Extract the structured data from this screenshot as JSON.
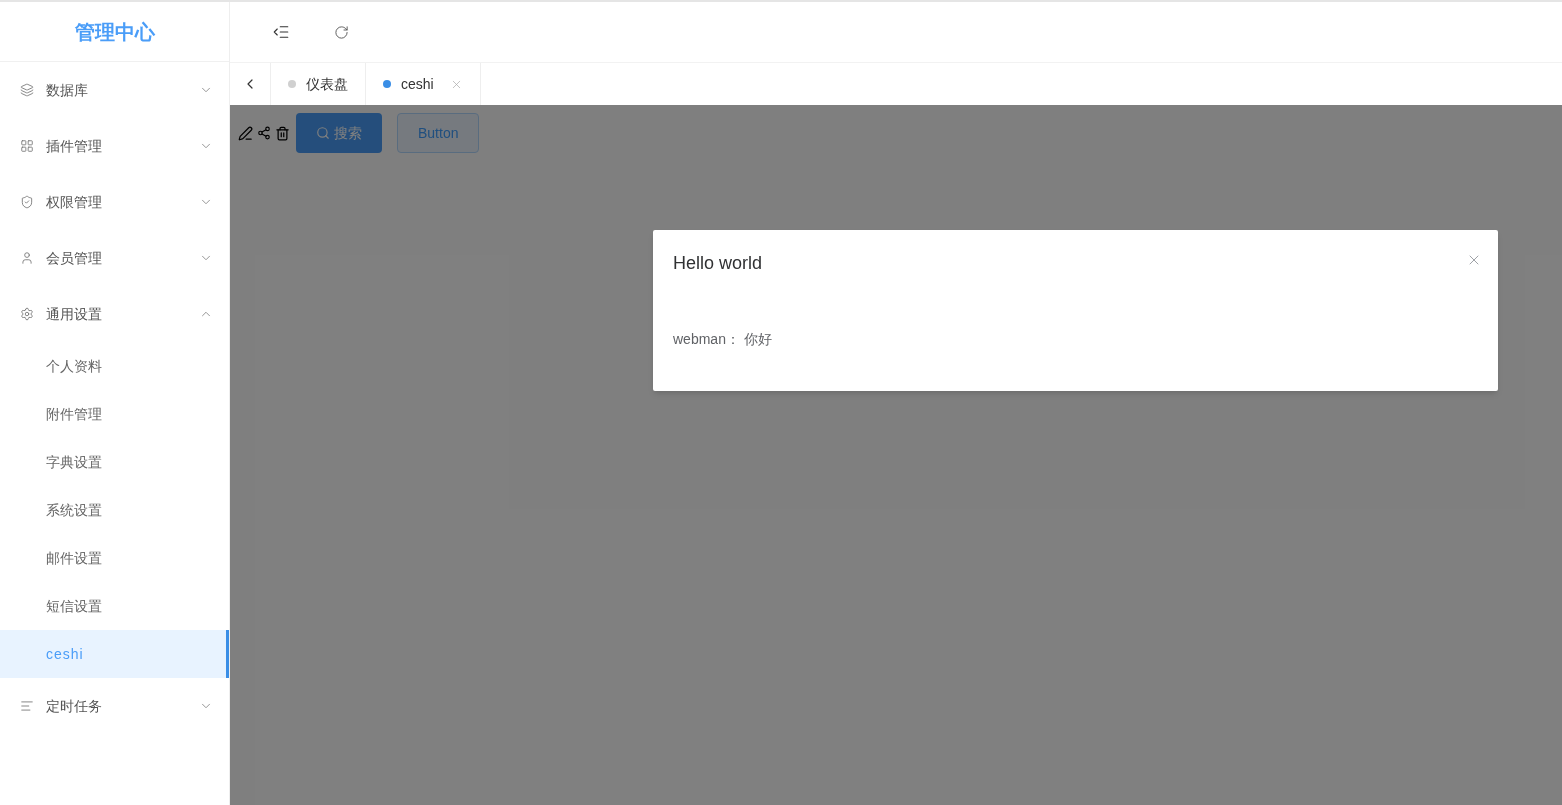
{
  "logo": "管理中心",
  "menu": [
    {
      "label": "数据库",
      "expanded": false
    },
    {
      "label": "插件管理",
      "expanded": false
    },
    {
      "label": "权限管理",
      "expanded": false
    },
    {
      "label": "会员管理",
      "expanded": false
    },
    {
      "label": "通用设置",
      "expanded": true,
      "children": [
        {
          "label": "个人资料",
          "selected": false
        },
        {
          "label": "附件管理",
          "selected": false
        },
        {
          "label": "字典设置",
          "selected": false
        },
        {
          "label": "系统设置",
          "selected": false
        },
        {
          "label": "邮件设置",
          "selected": false
        },
        {
          "label": "短信设置",
          "selected": false
        },
        {
          "label": "ceshi",
          "selected": true
        }
      ]
    },
    {
      "label": "定时任务",
      "expanded": false
    }
  ],
  "tabs": [
    {
      "label": "仪表盘",
      "selected": false,
      "closable": false
    },
    {
      "label": "ceshi",
      "selected": true,
      "closable": true
    }
  ],
  "toolbar": {
    "search_button": "搜索",
    "button": "Button"
  },
  "dialog": {
    "title": "Hello world",
    "body": "webman： 你好"
  }
}
